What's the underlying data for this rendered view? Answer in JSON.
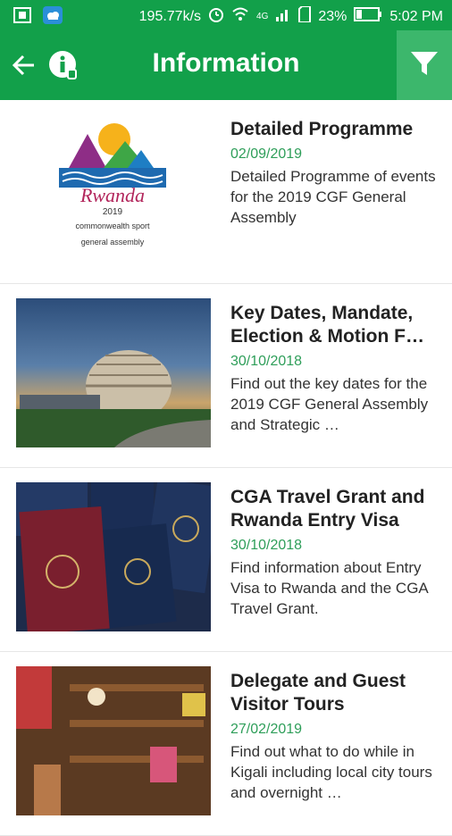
{
  "status_bar": {
    "network_speed": "195.77k/s",
    "network_type": "4G",
    "battery_percent": "23%",
    "time": "5:02 PM"
  },
  "app_bar": {
    "title": "Information"
  },
  "list": {
    "items": [
      {
        "title": "Detailed Programme",
        "date": "02/09/2019",
        "description": "Detailed Programme of events for the 2019 CGF General Assembly",
        "logo_text_1": "Rwanda",
        "logo_text_2": "2019",
        "logo_text_3": "commonwealth sport",
        "logo_text_4": "general assembly"
      },
      {
        "title": "Key Dates, Mandate, Election & Motion F…",
        "date": "30/10/2018",
        "description": "Find out the key dates for the 2019 CGF General Assembly and Strategic …"
      },
      {
        "title": "CGA Travel Grant and Rwanda Entry Visa",
        "date": "30/10/2018",
        "description": "Find information about Entry Visa to Rwanda and the CGA Travel Grant."
      },
      {
        "title": "Delegate and Guest Visitor Tours",
        "date": "27/02/2019",
        "description": "Find out what to do while in Kigali including local city tours and overnight …"
      }
    ]
  },
  "colors": {
    "primary": "#12a04a",
    "filter_button": "#3cb76c",
    "date_text": "#2e9e59"
  }
}
